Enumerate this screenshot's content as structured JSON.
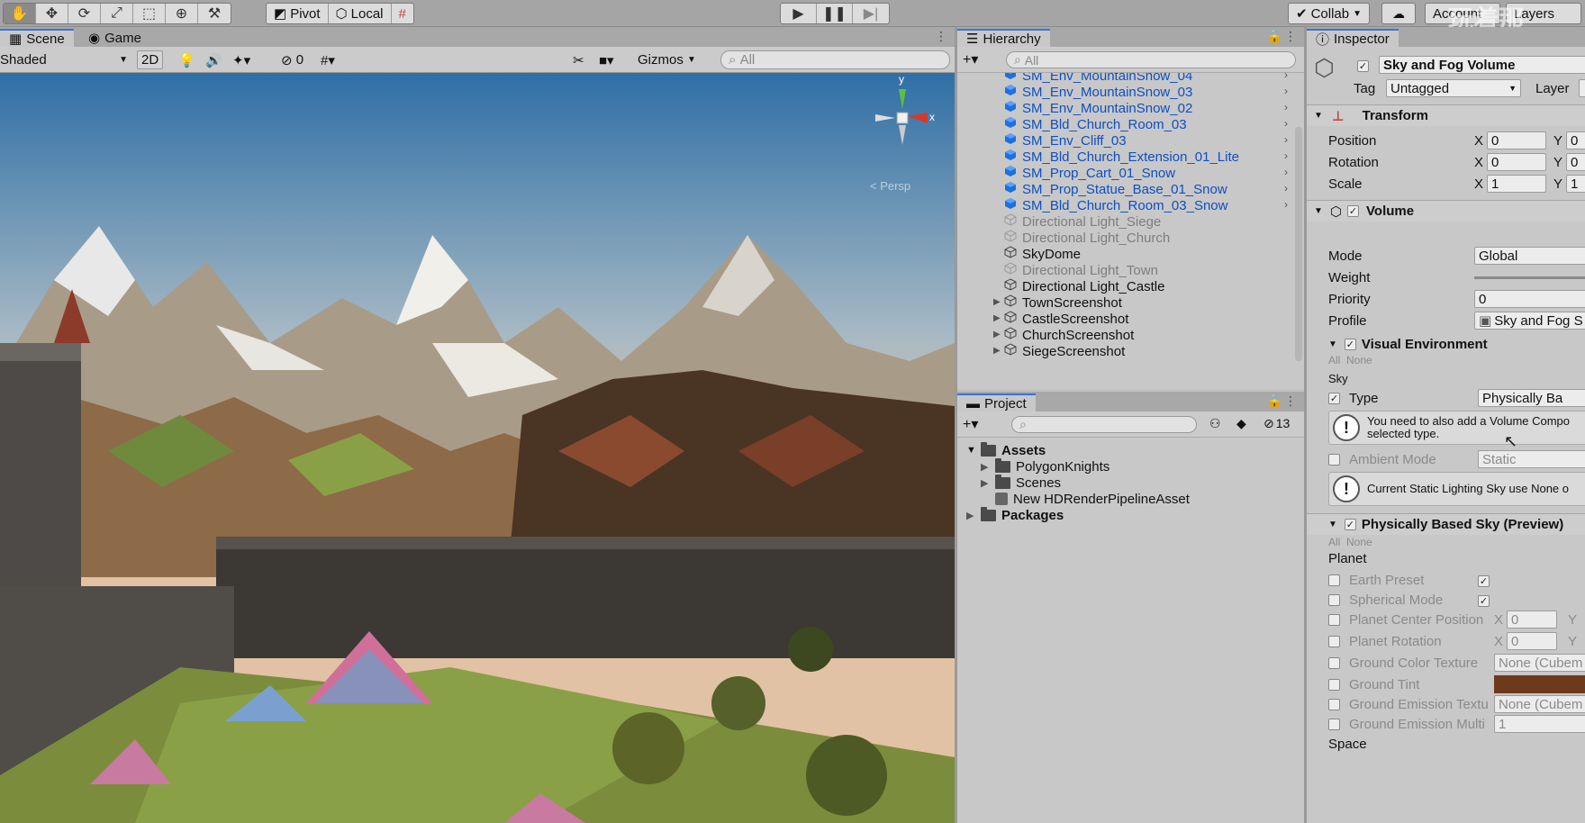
{
  "toolbar": {
    "pivot_label": "Pivot",
    "local_label": "Local",
    "collab_label": "Collab",
    "account_label": "Account",
    "layers_label": "Layers",
    "watermark": "玩着那"
  },
  "scene": {
    "tab_scene": "Scene",
    "tab_game": "Game",
    "shading_mode": "Shaded",
    "mode_2d": "2D",
    "hidden_count": "0",
    "gizmos_label": "Gizmos",
    "search_placeholder": "All",
    "gizmo_y": "y",
    "gizmo_x": "x",
    "persp_label": "< Persp"
  },
  "hierarchy": {
    "tab_label": "Hierarchy",
    "search_placeholder": "All",
    "items": [
      {
        "label": "SM_Env_MountainSnow_04",
        "style": "blue"
      },
      {
        "label": "SM_Env_MountainSnow_03",
        "style": "blue"
      },
      {
        "label": "SM_Env_MountainSnow_02",
        "style": "blue"
      },
      {
        "label": "SM_Bld_Church_Room_03",
        "style": "blue"
      },
      {
        "label": "SM_Env_Cliff_03",
        "style": "blue"
      },
      {
        "label": "SM_Bld_Church_Extension_01_Lite",
        "style": "blue"
      },
      {
        "label": "SM_Prop_Cart_01_Snow",
        "style": "blue"
      },
      {
        "label": "SM_Prop_Statue_Base_01_Snow",
        "style": "blue"
      },
      {
        "label": "SM_Bld_Church_Room_03_Snow",
        "style": "blue"
      },
      {
        "label": "Directional Light_Siege",
        "style": "disabled"
      },
      {
        "label": "Directional Light_Church",
        "style": "disabled"
      },
      {
        "label": "SkyDome",
        "style": "normal"
      },
      {
        "label": "Directional Light_Town",
        "style": "disabled"
      },
      {
        "label": "Directional Light_Castle",
        "style": "normal"
      },
      {
        "label": "TownScreenshot",
        "style": "normal"
      },
      {
        "label": "CastleScreenshot",
        "style": "normal"
      },
      {
        "label": "ChurchScreenshot",
        "style": "normal"
      },
      {
        "label": "SiegeScreenshot",
        "style": "normal"
      }
    ]
  },
  "project": {
    "tab_label": "Project",
    "hidden_count": "13",
    "assets_label": "Assets",
    "children": [
      "PolygonKnights",
      "Scenes",
      "New HDRenderPipelineAsset"
    ],
    "packages_label": "Packages"
  },
  "inspector": {
    "tab_label": "Inspector",
    "object_name": "Sky and Fog Volume",
    "tag_label": "Tag",
    "tag_value": "Untagged",
    "layer_label": "Layer",
    "transform": {
      "title": "Transform",
      "position_label": "Position",
      "rotation_label": "Rotation",
      "scale_label": "Scale",
      "x_label": "X",
      "y_label": "Y",
      "position": [
        "0",
        "0"
      ],
      "rotation": [
        "0",
        "0"
      ],
      "scale": [
        "1",
        "1"
      ]
    },
    "volume": {
      "title": "Volume",
      "mode_label": "Mode",
      "mode_value": "Global",
      "weight_label": "Weight",
      "priority_label": "Priority",
      "priority_value": "0",
      "profile_label": "Profile",
      "profile_value": "Sky and Fog S"
    },
    "visual_env": {
      "title": "Visual Environment",
      "all_label": "All",
      "none_label": "None",
      "sky_label": "Sky",
      "type_label": "Type",
      "type_value": "Physically Ba",
      "help_text": "You need to also add a Volume Compo selected type.",
      "ambient_label": "Ambient Mode",
      "ambient_value": "Static",
      "help_text2": "Current Static Lighting Sky use None o"
    },
    "pbsky": {
      "title": "Physically Based Sky (Preview)",
      "all_label": "All",
      "none_label": "None",
      "planet_label": "Planet",
      "earth_preset": "Earth Preset",
      "spherical_mode": "Spherical Mode",
      "planet_center": "Planet Center Position",
      "planet_rotation": "Planet Rotation",
      "ground_color_texture": "Ground Color Texture",
      "ground_color_value": "None (Cubem",
      "ground_tint": "Ground Tint",
      "ground_emission_texture": "Ground Emission Textu",
      "ground_emission_value": "None (Cubem",
      "ground_emission_multi": "Ground Emission Multi",
      "ground_emission_multi_value": "1",
      "x_label": "X",
      "y_label": "Y",
      "zero": "0",
      "space_label": "Space",
      "ground_tint_color": "#6e3a1c"
    }
  }
}
